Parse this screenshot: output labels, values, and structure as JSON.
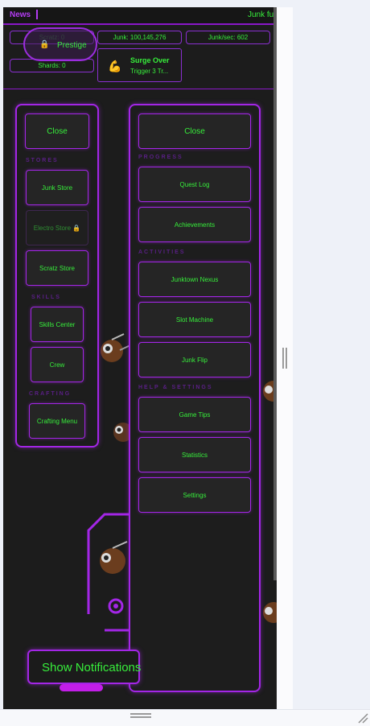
{
  "news": {
    "label": "News",
    "ticker": "Junk futures"
  },
  "stats": {
    "scratz": "Scratz: 0",
    "junk": "Junk: 100,145,276",
    "junk_per_sec": "Junk/sec: 602",
    "shards": "Shards: 0"
  },
  "prestige": {
    "label": "Prestige",
    "icon": "lock-icon"
  },
  "surge": {
    "title": "Surge Over",
    "subtitle": "Trigger 3 Tr...",
    "icon": "flexed-bicep-icon"
  },
  "left_menu": {
    "close": "Close",
    "stores_title": "STORES",
    "junk_store": "Junk Store",
    "electro_store": "Electro Store 🔒",
    "scratz_store": "Scratz Store",
    "skills_title": "SKILLS",
    "skills_center": "Skills Center",
    "crew": "Crew",
    "crafting_title": "CRAFTING",
    "crafting_menu": "Crafting Menu"
  },
  "right_menu": {
    "close": "Close",
    "progress_title": "PROGRESS",
    "quest_log": "Quest Log",
    "achievements": "Achievements",
    "activities_title": "ACTIVITIES",
    "junktown_nexus": "Junktown Nexus",
    "slot_machine": "Slot Machine",
    "junk_flip": "Junk Flip",
    "help_title": "HELP & SETTINGS",
    "game_tips": "Game Tips",
    "statistics": "Statistics",
    "settings": "Settings"
  },
  "notifications": {
    "label": "Show Notifications"
  },
  "colors": {
    "accent": "#a326e6",
    "text_green": "#37ee3b",
    "background": "#1c1c1c"
  }
}
